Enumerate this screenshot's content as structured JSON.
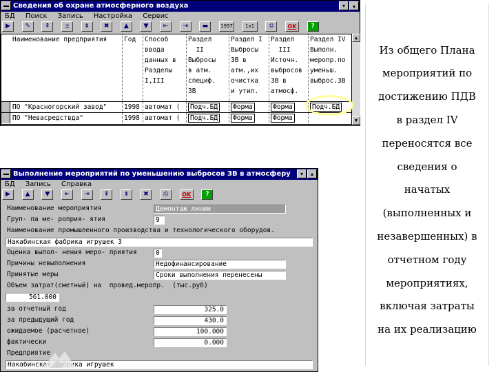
{
  "top_window": {
    "title": "Сведения об охране атмосферного воздуха",
    "menu": [
      "БД",
      "Поиск",
      "Запись",
      "Настройка",
      "Сервис"
    ],
    "toolbar_text": [
      "1997",
      "1x1"
    ],
    "ok_label": "OK",
    "help_label": "?",
    "columns": [
      "Наименование предприятия",
      "Год",
      "Способ\nввода\nданных в\nРазделы\nI,III",
      "Раздел\n  II\nВыбросы\nв атм.\nспециф.\nЗВ",
      "Раздел I\nВыбросы\nЗВ в\nатм.,их\nочистка\nи утил.",
      "Раздел\n  III\nИсточн.\nвыбросов\nЗВ в\nатмосф.",
      "Раздел IV\nВыполн.\nмеропр.по\nуменьш.\nвыброс.ЗВ"
    ],
    "rows": [
      [
        "ПО \"Красногорский завод\"",
        "1998",
        "автомат (",
        "Подч.БД",
        "Форма",
        "Форма",
        "Подч.БД"
      ],
      [
        "ПО \"Невасредствда\"",
        "1998",
        "автомат (",
        "Подч.БД",
        "Форма",
        "Форма",
        ""
      ]
    ]
  },
  "bottom_window": {
    "title": "Выполнение мероприятий по уменьшению выбросов ЗВ в атмосферу",
    "menu": [
      "БД",
      "Запись",
      "Справка"
    ],
    "ok_label": "OK",
    "help_label": "?",
    "fields": {
      "event_name_label": "Наименование мероприятия",
      "event_name_value": "Демонтаж линии",
      "group_label": "Груп- па ме- роприя- ятия",
      "group_value": "9",
      "process_label": "Наименование промышленного производства и технологического оборудов.",
      "process_value": "Накабинская фабрика игрушек 3",
      "assessment_label": "Оценка выпол- нения меро- приятия",
      "assessment_value": "0",
      "reason_label": "Причины невыполнения",
      "reason_value": "Недофинансирование",
      "measures_label": "Принятые меры",
      "measures_value": "Сроки выполнения перенесены",
      "cost_label": "Объем затрат(сметный) на  провед.меропр.  (тыс.руб)",
      "cost_value": "561.000",
      "year_label": "за отчетный год",
      "year_value": "325.0",
      "prev_year_label": "за предыдущий год",
      "prev_year_value": "430.0",
      "expected_label": "ожидаемое (расчетное)",
      "expected_value": "100.000",
      "actual_label": "фактически",
      "actual_value": "0.000",
      "enterprise_label": "Предприятие",
      "enterprise_value": "Накабинская фабрика игрушек"
    }
  },
  "caption": [
    "Из общего Плана",
    "мероприятий по",
    "достижению ПДВ",
    "в раздел IV",
    "переносятся все",
    "сведения о",
    "начатых",
    "(выполненных и",
    "незавершенных) в",
    "отчетном году",
    "мероприятиях,",
    "включая  затраты",
    "на их реализацию"
  ],
  "colors": {
    "titlebar": "#00007b",
    "window_face": "#c0c0c0",
    "highlight_ring": "#ffff99"
  }
}
